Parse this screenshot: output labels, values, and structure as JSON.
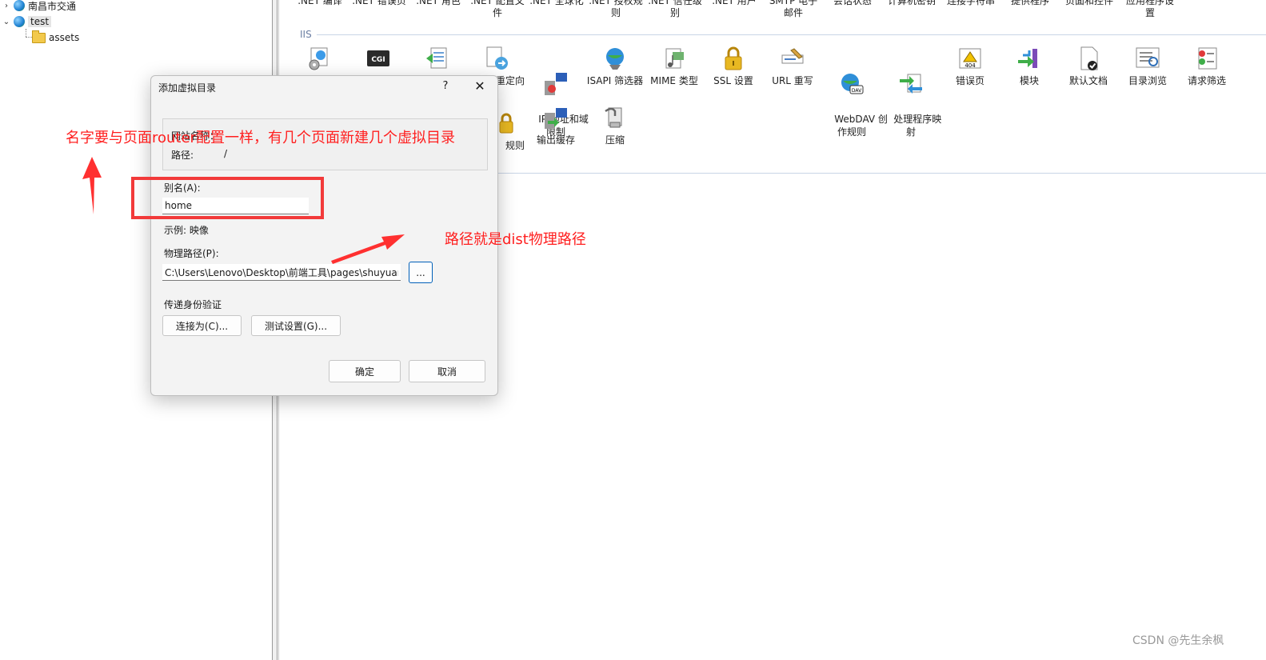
{
  "tree": {
    "items": [
      {
        "label": "南昌市交通",
        "expanded": false
      },
      {
        "label": "test",
        "expanded": true,
        "selected": true
      },
      {
        "label": "assets"
      }
    ]
  },
  "top_row_labels": [
    ".NET 编译",
    ".NET 错误页",
    ".NET 角色",
    ".NET 配置文\n件",
    ".NET 全球化",
    ".NET 授权规\n则",
    ".NET 信任级\n别",
    ".NET 用户",
    "SMTP 电子\n邮件",
    "会话状态",
    "计算机密钥",
    "连接字符串",
    "提供程序",
    "页面和控件",
    "应用程序设\n置"
  ],
  "iis_group": {
    "title": "IIS",
    "features_row1": [
      {
        "label": "",
        "icon": "asp-gear-icon"
      },
      {
        "label": "",
        "icon": "cgi-icon"
      },
      {
        "label": "",
        "icon": "default-doc-edit-icon"
      },
      {
        "label": "重定向",
        "icon": "http-redirect-icon"
      },
      {
        "label": "IP 地址和域\n限制",
        "icon": "ip-restriction-icon"
      },
      {
        "label": "ISAPI 筛选器",
        "icon": "isapi-filter-icon"
      },
      {
        "label": "MIME 类型",
        "icon": "mime-type-icon"
      },
      {
        "label": "SSL 设置",
        "icon": "ssl-lock-icon"
      },
      {
        "label": "URL 重写",
        "icon": "url-rewrite-icon"
      },
      {
        "label": "WebDAV 创\n作规则",
        "icon": "webdav-icon"
      },
      {
        "label": "处理程序映\n射",
        "icon": "handler-mapping-icon"
      },
      {
        "label": "错误页",
        "icon": "error-page-icon"
      },
      {
        "label": "模块",
        "icon": "modules-icon"
      },
      {
        "label": "默认文档",
        "icon": "default-document-icon"
      },
      {
        "label": "目录浏览",
        "icon": "directory-browsing-icon"
      },
      {
        "label": "请求筛选",
        "icon": "request-filtering-icon"
      }
    ],
    "features_row2": [
      {
        "label": "规则",
        "icon": "authorization-rules-icon"
      },
      {
        "label": "输出缓存",
        "icon": "output-cache-icon"
      },
      {
        "label": "压缩",
        "icon": "compression-icon"
      }
    ]
  },
  "dialog": {
    "title": "添加虚拟目录",
    "help": "?",
    "close": "✕",
    "site_name_label": "网站名称：",
    "path_label": "路径:",
    "path_value": "/",
    "alias_label": "别名(A):",
    "alias_value": "home",
    "example": "示例: 映像",
    "physical_path_label": "物理路径(P):",
    "physical_path_value": "C:\\Users\\Lenovo\\Desktop\\前端工具\\pages\\shuyuan\\",
    "browse_label": "...",
    "auth_label": "传递身份验证",
    "connect_as": "连接为(C)...",
    "test_settings": "测试设置(G)...",
    "ok": "确定",
    "cancel": "取消"
  },
  "annotations": {
    "alias_note": "名字要与页面router配置一样，有几个页面新建几个虚拟目录",
    "path_note": "路径就是dist物理路径",
    "color": "#ff1f1f"
  },
  "watermark": "CSDN @先生余枫"
}
